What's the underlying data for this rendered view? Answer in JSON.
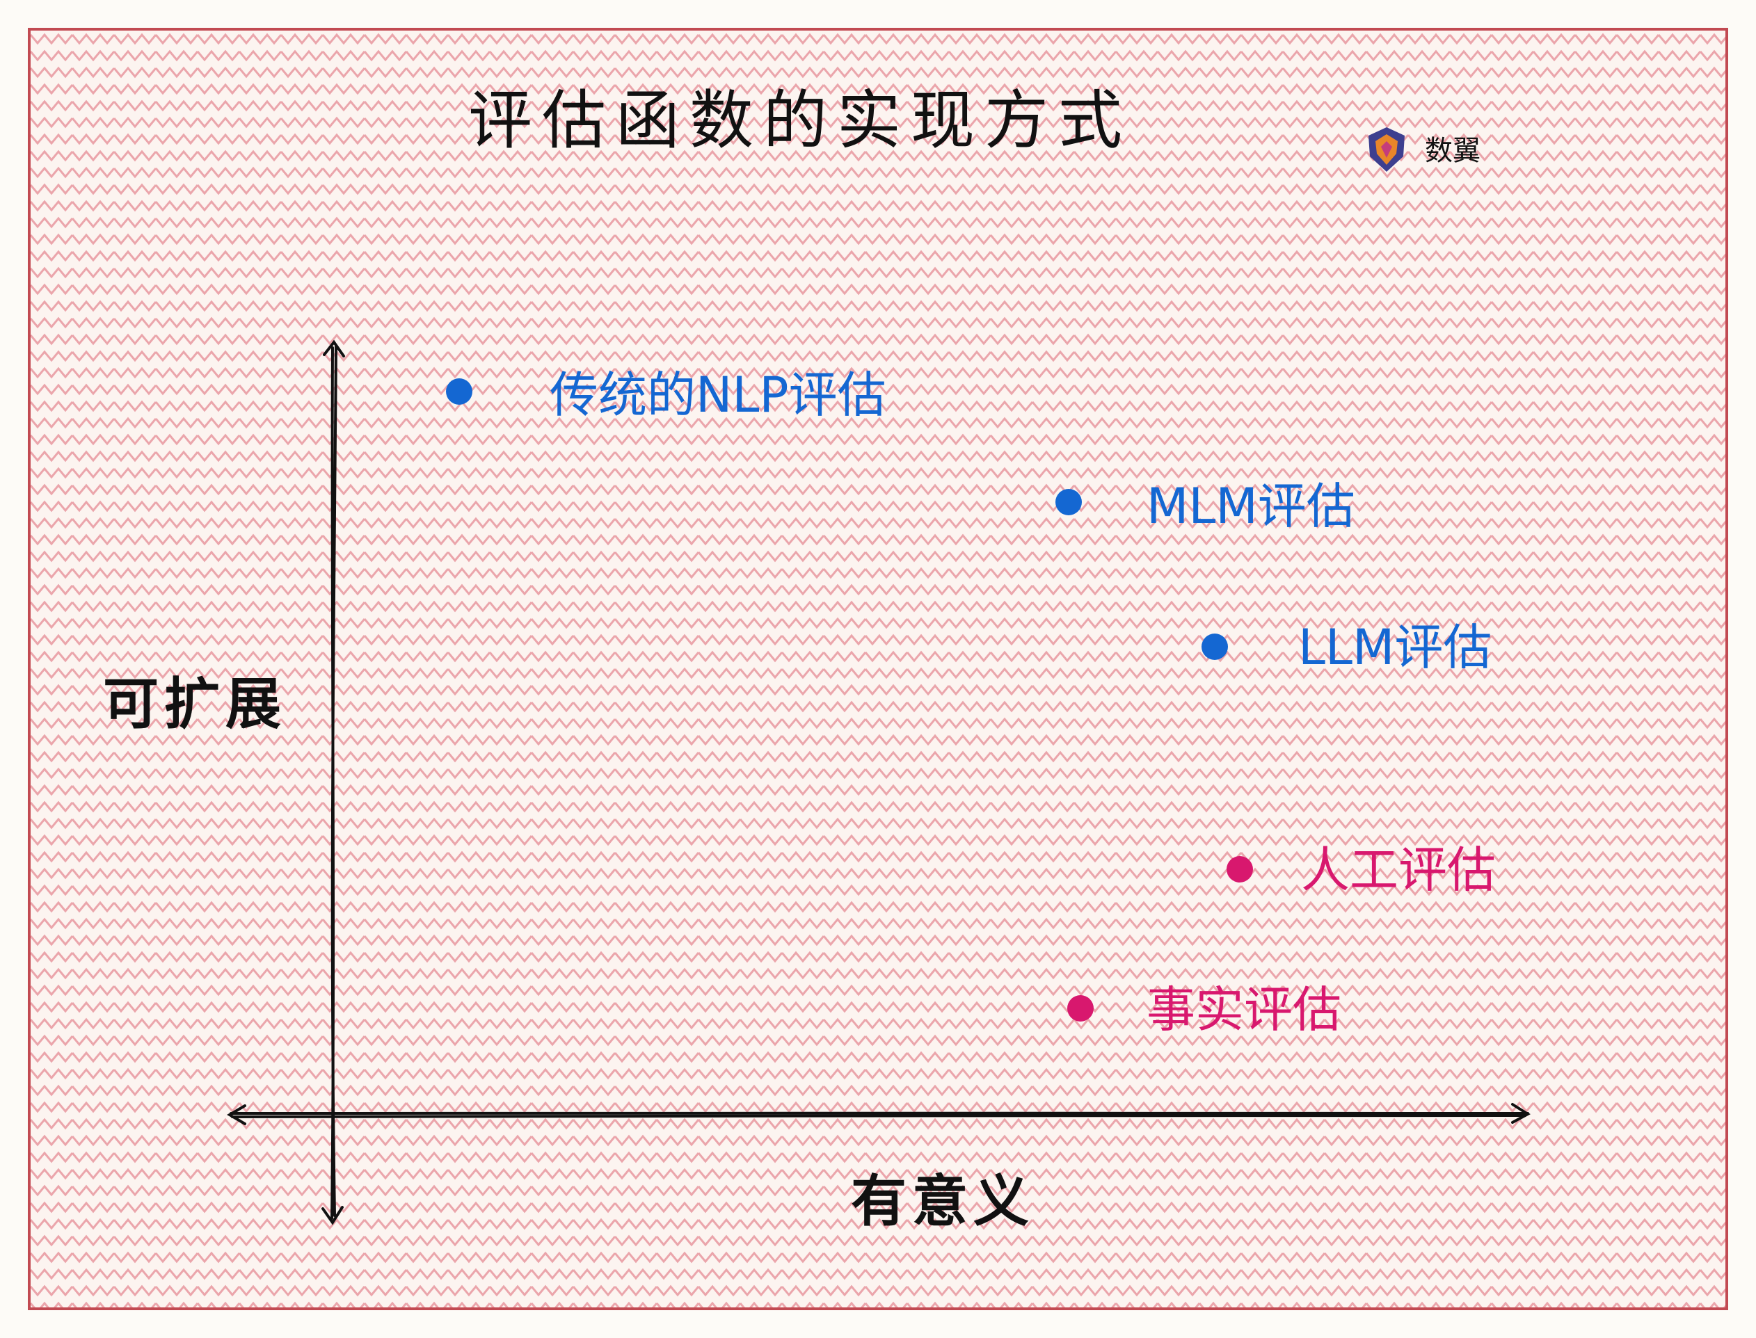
{
  "title": "评估函数的实现方式",
  "brand": {
    "name": "数翼",
    "icon": "shield-logo-icon"
  },
  "axes": {
    "y_label": "可扩展",
    "x_label": "有意义"
  },
  "points": [
    {
      "label": "传统的NLP评估",
      "color": "#1467d2"
    },
    {
      "label": "MLM评估",
      "color": "#1467d2"
    },
    {
      "label": "LLM评估",
      "color": "#1467d2"
    },
    {
      "label": "人工评估",
      "color": "#d8186e"
    },
    {
      "label": "事实评估",
      "color": "#d8186e"
    }
  ],
  "colors": {
    "frame": "#c24a52",
    "background": "#fcf4f0",
    "pattern": "#eba5ab",
    "ink": "#111111"
  }
}
